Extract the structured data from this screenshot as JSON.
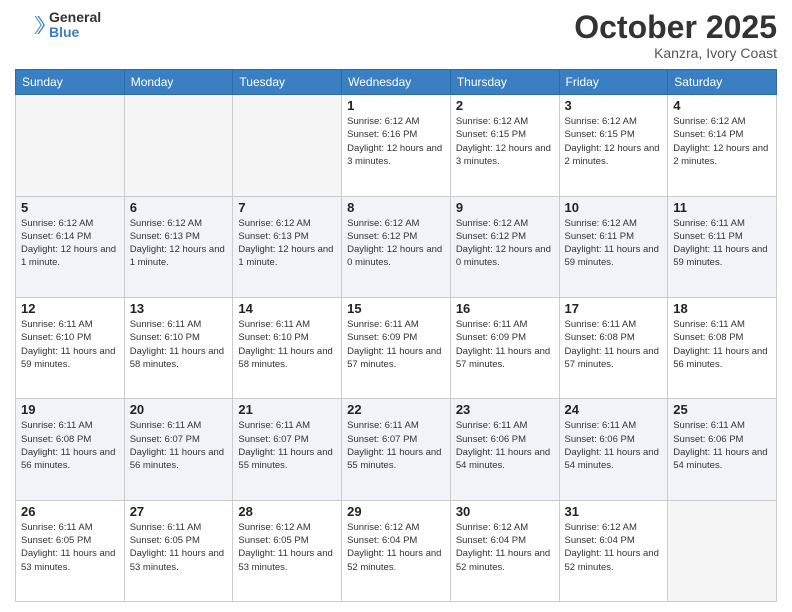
{
  "header": {
    "logo_general": "General",
    "logo_blue": "Blue",
    "month": "October 2025",
    "location": "Kanzra, Ivory Coast"
  },
  "weekdays": [
    "Sunday",
    "Monday",
    "Tuesday",
    "Wednesday",
    "Thursday",
    "Friday",
    "Saturday"
  ],
  "weeks": [
    [
      {
        "day": "",
        "info": ""
      },
      {
        "day": "",
        "info": ""
      },
      {
        "day": "",
        "info": ""
      },
      {
        "day": "1",
        "info": "Sunrise: 6:12 AM\nSunset: 6:16 PM\nDaylight: 12 hours and 3 minutes."
      },
      {
        "day": "2",
        "info": "Sunrise: 6:12 AM\nSunset: 6:15 PM\nDaylight: 12 hours and 3 minutes."
      },
      {
        "day": "3",
        "info": "Sunrise: 6:12 AM\nSunset: 6:15 PM\nDaylight: 12 hours and 2 minutes."
      },
      {
        "day": "4",
        "info": "Sunrise: 6:12 AM\nSunset: 6:14 PM\nDaylight: 12 hours and 2 minutes."
      }
    ],
    [
      {
        "day": "5",
        "info": "Sunrise: 6:12 AM\nSunset: 6:14 PM\nDaylight: 12 hours and 1 minute."
      },
      {
        "day": "6",
        "info": "Sunrise: 6:12 AM\nSunset: 6:13 PM\nDaylight: 12 hours and 1 minute."
      },
      {
        "day": "7",
        "info": "Sunrise: 6:12 AM\nSunset: 6:13 PM\nDaylight: 12 hours and 1 minute."
      },
      {
        "day": "8",
        "info": "Sunrise: 6:12 AM\nSunset: 6:12 PM\nDaylight: 12 hours and 0 minutes."
      },
      {
        "day": "9",
        "info": "Sunrise: 6:12 AM\nSunset: 6:12 PM\nDaylight: 12 hours and 0 minutes."
      },
      {
        "day": "10",
        "info": "Sunrise: 6:12 AM\nSunset: 6:11 PM\nDaylight: 11 hours and 59 minutes."
      },
      {
        "day": "11",
        "info": "Sunrise: 6:11 AM\nSunset: 6:11 PM\nDaylight: 11 hours and 59 minutes."
      }
    ],
    [
      {
        "day": "12",
        "info": "Sunrise: 6:11 AM\nSunset: 6:10 PM\nDaylight: 11 hours and 59 minutes."
      },
      {
        "day": "13",
        "info": "Sunrise: 6:11 AM\nSunset: 6:10 PM\nDaylight: 11 hours and 58 minutes."
      },
      {
        "day": "14",
        "info": "Sunrise: 6:11 AM\nSunset: 6:10 PM\nDaylight: 11 hours and 58 minutes."
      },
      {
        "day": "15",
        "info": "Sunrise: 6:11 AM\nSunset: 6:09 PM\nDaylight: 11 hours and 57 minutes."
      },
      {
        "day": "16",
        "info": "Sunrise: 6:11 AM\nSunset: 6:09 PM\nDaylight: 11 hours and 57 minutes."
      },
      {
        "day": "17",
        "info": "Sunrise: 6:11 AM\nSunset: 6:08 PM\nDaylight: 11 hours and 57 minutes."
      },
      {
        "day": "18",
        "info": "Sunrise: 6:11 AM\nSunset: 6:08 PM\nDaylight: 11 hours and 56 minutes."
      }
    ],
    [
      {
        "day": "19",
        "info": "Sunrise: 6:11 AM\nSunset: 6:08 PM\nDaylight: 11 hours and 56 minutes."
      },
      {
        "day": "20",
        "info": "Sunrise: 6:11 AM\nSunset: 6:07 PM\nDaylight: 11 hours and 56 minutes."
      },
      {
        "day": "21",
        "info": "Sunrise: 6:11 AM\nSunset: 6:07 PM\nDaylight: 11 hours and 55 minutes."
      },
      {
        "day": "22",
        "info": "Sunrise: 6:11 AM\nSunset: 6:07 PM\nDaylight: 11 hours and 55 minutes."
      },
      {
        "day": "23",
        "info": "Sunrise: 6:11 AM\nSunset: 6:06 PM\nDaylight: 11 hours and 54 minutes."
      },
      {
        "day": "24",
        "info": "Sunrise: 6:11 AM\nSunset: 6:06 PM\nDaylight: 11 hours and 54 minutes."
      },
      {
        "day": "25",
        "info": "Sunrise: 6:11 AM\nSunset: 6:06 PM\nDaylight: 11 hours and 54 minutes."
      }
    ],
    [
      {
        "day": "26",
        "info": "Sunrise: 6:11 AM\nSunset: 6:05 PM\nDaylight: 11 hours and 53 minutes."
      },
      {
        "day": "27",
        "info": "Sunrise: 6:11 AM\nSunset: 6:05 PM\nDaylight: 11 hours and 53 minutes."
      },
      {
        "day": "28",
        "info": "Sunrise: 6:12 AM\nSunset: 6:05 PM\nDaylight: 11 hours and 53 minutes."
      },
      {
        "day": "29",
        "info": "Sunrise: 6:12 AM\nSunset: 6:04 PM\nDaylight: 11 hours and 52 minutes."
      },
      {
        "day": "30",
        "info": "Sunrise: 6:12 AM\nSunset: 6:04 PM\nDaylight: 11 hours and 52 minutes."
      },
      {
        "day": "31",
        "info": "Sunrise: 6:12 AM\nSunset: 6:04 PM\nDaylight: 11 hours and 52 minutes."
      },
      {
        "day": "",
        "info": ""
      }
    ]
  ]
}
